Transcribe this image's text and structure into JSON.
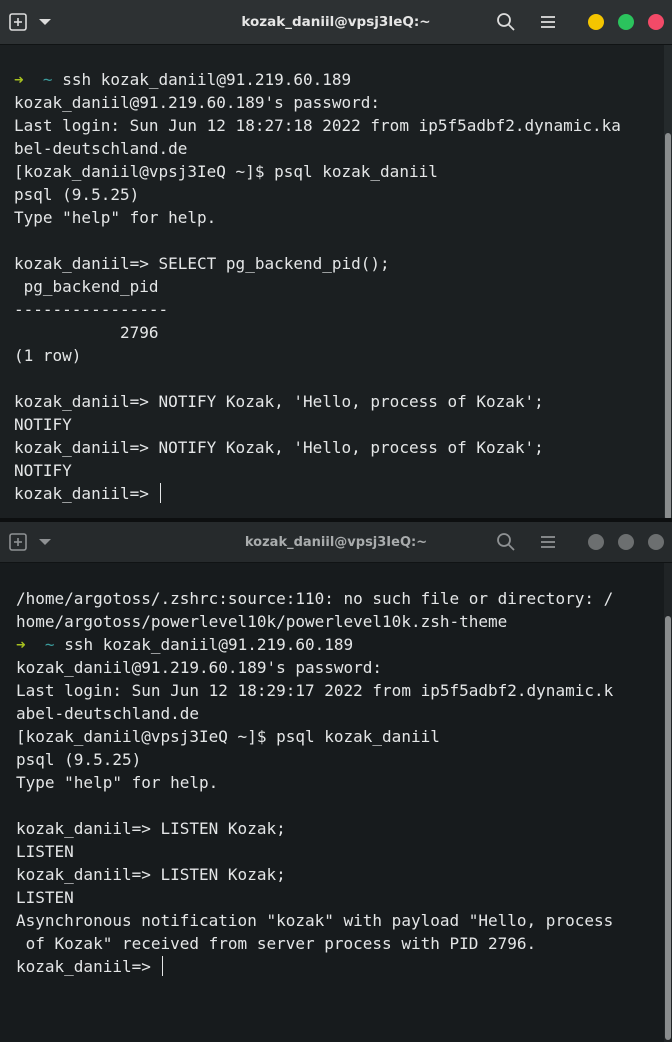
{
  "windows": [
    {
      "title": "kozak_daniil@vpsj3IeQ:~",
      "buttons": {
        "new_tab": "new-tab-icon",
        "tab_menu": "chevron-down-icon",
        "search": "search-icon",
        "menu": "hamburger-menu-icon"
      },
      "controls": {
        "minimize_color": "#f4c500",
        "maximize_color": "#2bc35d",
        "close_color": "#f24a68"
      },
      "lines": [
        {
          "arrow": "➜",
          "tilde": "~",
          "text": "ssh kozak_daniil@91.219.60.189"
        },
        {
          "text": "kozak_daniil@91.219.60.189's password:"
        },
        {
          "text": "Last login: Sun Jun 12 18:27:18 2022 from ip5f5adbf2.dynamic.ka"
        },
        {
          "text": "bel-deutschland.de"
        },
        {
          "text": "[kozak_daniil@vpsj3IeQ ~]$ psql kozak_daniil"
        },
        {
          "text": "psql (9.5.25)"
        },
        {
          "text": "Type \"help\" for help."
        },
        {
          "text": ""
        },
        {
          "text": "kozak_daniil=> SELECT pg_backend_pid();"
        },
        {
          "text": " pg_backend_pid"
        },
        {
          "text": "----------------"
        },
        {
          "text": "           2796"
        },
        {
          "text": "(1 row)"
        },
        {
          "text": ""
        },
        {
          "text": "kozak_daniil=> NOTIFY Kozak, 'Hello, process of Kozak';"
        },
        {
          "text": "NOTIFY"
        },
        {
          "text": "kozak_daniil=> NOTIFY Kozak, 'Hello, process of Kozak';"
        },
        {
          "text": "NOTIFY"
        },
        {
          "text": "kozak_daniil=> ",
          "cursor": true
        }
      ]
    },
    {
      "title": "kozak_daniil@vpsj3IeQ:~",
      "buttons": {
        "new_tab": "new-tab-icon",
        "tab_menu": "chevron-down-icon",
        "search": "search-icon",
        "menu": "hamburger-menu-icon"
      },
      "controls": {
        "minimize_color": "#6c6f70",
        "maximize_color": "#6c6f70",
        "close_color": "#6c6f70"
      },
      "lines": [
        {
          "text": "/home/argotoss/.zshrc:source:110: no such file or directory: /"
        },
        {
          "text": "home/argotoss/powerlevel10k/powerlevel10k.zsh-theme"
        },
        {
          "arrow": "➜",
          "tilde": "~",
          "text": "ssh kozak_daniil@91.219.60.189"
        },
        {
          "text": "kozak_daniil@91.219.60.189's password:"
        },
        {
          "text": "Last login: Sun Jun 12 18:29:17 2022 from ip5f5adbf2.dynamic.k"
        },
        {
          "text": "abel-deutschland.de"
        },
        {
          "text": "[kozak_daniil@vpsj3IeQ ~]$ psql kozak_daniil"
        },
        {
          "text": "psql (9.5.25)"
        },
        {
          "text": "Type \"help\" for help."
        },
        {
          "text": ""
        },
        {
          "text": "kozak_daniil=> LISTEN Kozak;"
        },
        {
          "text": "LISTEN"
        },
        {
          "text": "kozak_daniil=> LISTEN Kozak;"
        },
        {
          "text": "LISTEN"
        },
        {
          "text": "Asynchronous notification \"kozak\" with payload \"Hello, process"
        },
        {
          "text": " of Kozak\" received from server process with PID 2796."
        },
        {
          "text": "kozak_daniil=> ",
          "cursor": true
        }
      ]
    }
  ]
}
